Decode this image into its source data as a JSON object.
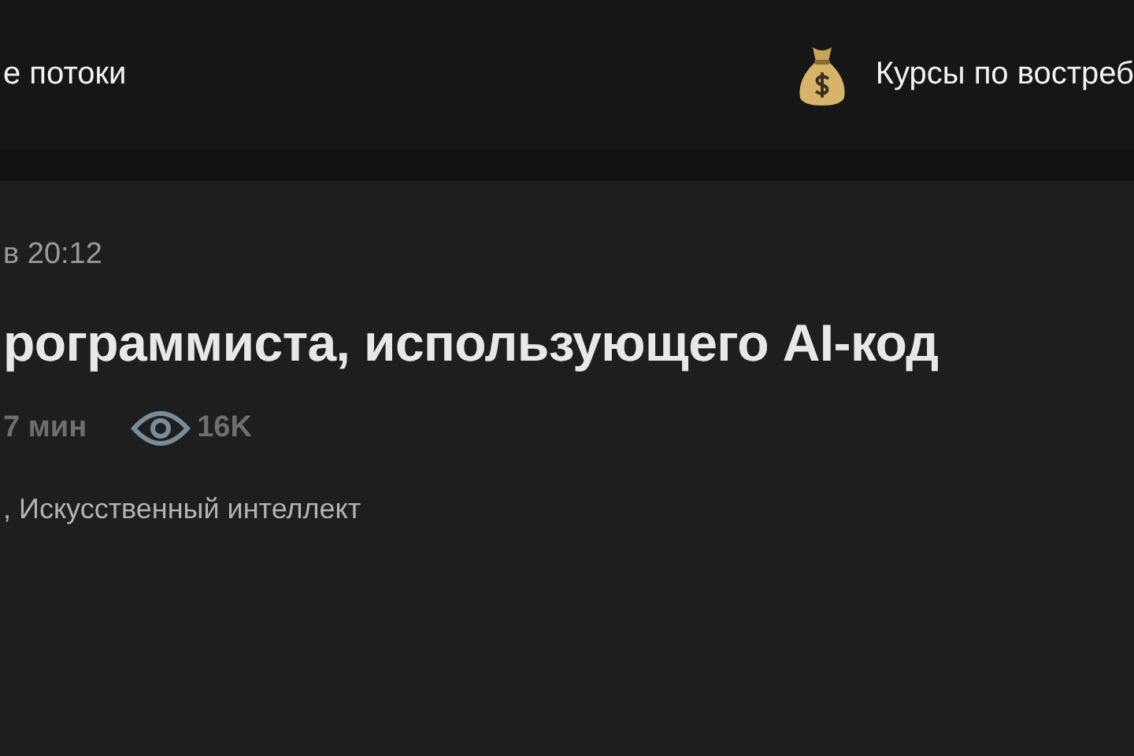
{
  "top_nav": {
    "items": [
      {
        "label": "е потоки",
        "kind": "text"
      },
      {
        "label": "Курсы по востреб",
        "kind": "promo"
      }
    ]
  },
  "article": {
    "date": "в 20:12",
    "title": "рограммиста, использующего AI-код",
    "reading_time": "7 мин",
    "views": "16K",
    "hubs": ", Искусственный интеллект"
  }
}
